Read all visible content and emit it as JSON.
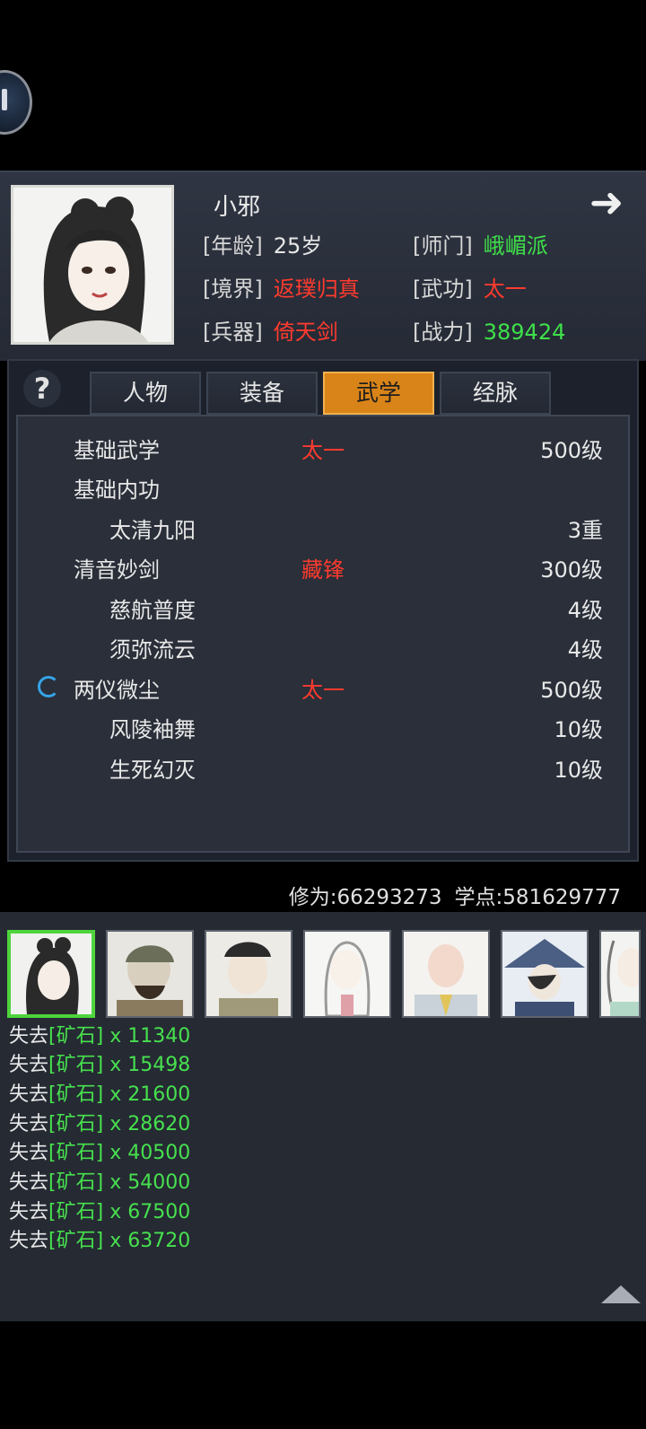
{
  "header": {
    "name": "小邪",
    "info": {
      "age": {
        "label": "[年龄]",
        "value": "25岁"
      },
      "sect": {
        "label": "[师门]",
        "value": "峨嵋派"
      },
      "realm": {
        "label": "[境界]",
        "value": "返璞归真"
      },
      "martial": {
        "label": "[武功]",
        "value": "太一"
      },
      "weapon": {
        "label": "[兵器]",
        "value": "倚天剑"
      },
      "power": {
        "label": "[战力]",
        "value": "389424"
      }
    }
  },
  "tabs": [
    {
      "label": "人物",
      "active": false
    },
    {
      "label": "装备",
      "active": false
    },
    {
      "label": "武学",
      "active": true
    },
    {
      "label": "经脉",
      "active": false
    }
  ],
  "skills": [
    {
      "name": "基础武学",
      "tag": "太一",
      "level": "500级",
      "indent": false
    },
    {
      "name": "基础内功",
      "tag": "",
      "level": "",
      "indent": false
    },
    {
      "name": "太清九阳",
      "tag": "",
      "level": "3重",
      "indent": true
    },
    {
      "name": "清音妙剑",
      "tag": "藏锋",
      "level": "300级",
      "indent": false
    },
    {
      "name": "慈航普度",
      "tag": "",
      "level": "4级",
      "indent": true
    },
    {
      "name": "须弥流云",
      "tag": "",
      "level": "4级",
      "indent": true
    },
    {
      "name": "两仪微尘",
      "tag": "太一",
      "level": "500级",
      "indent": false
    },
    {
      "name": "风陵袖舞",
      "tag": "",
      "level": "10级",
      "indent": true
    },
    {
      "name": "生死幻灭",
      "tag": "",
      "level": "10级",
      "indent": true
    }
  ],
  "stats": {
    "cultivation": "修为:66293273",
    "points": "学点:581629777"
  },
  "log": [
    {
      "prefix": "失去",
      "item": "[矿石]",
      "amount": "x 11340"
    },
    {
      "prefix": "失去",
      "item": "[矿石]",
      "amount": "x 15498"
    },
    {
      "prefix": "失去",
      "item": "[矿石]",
      "amount": "x 21600"
    },
    {
      "prefix": "失去",
      "item": "[矿石]",
      "amount": "x 28620"
    },
    {
      "prefix": "失去",
      "item": "[矿石]",
      "amount": "x 40500"
    },
    {
      "prefix": "失去",
      "item": "[矿石]",
      "amount": "x 54000"
    },
    {
      "prefix": "失去",
      "item": "[矿石]",
      "amount": "x 67500"
    },
    {
      "prefix": "失去",
      "item": "[矿石]",
      "amount": "x 63720"
    }
  ],
  "colors": {
    "accent_tab": "#d98418",
    "red_value": "#ff3a2e",
    "green_value": "#3fe04a",
    "selected_border": "#4fd43d"
  }
}
